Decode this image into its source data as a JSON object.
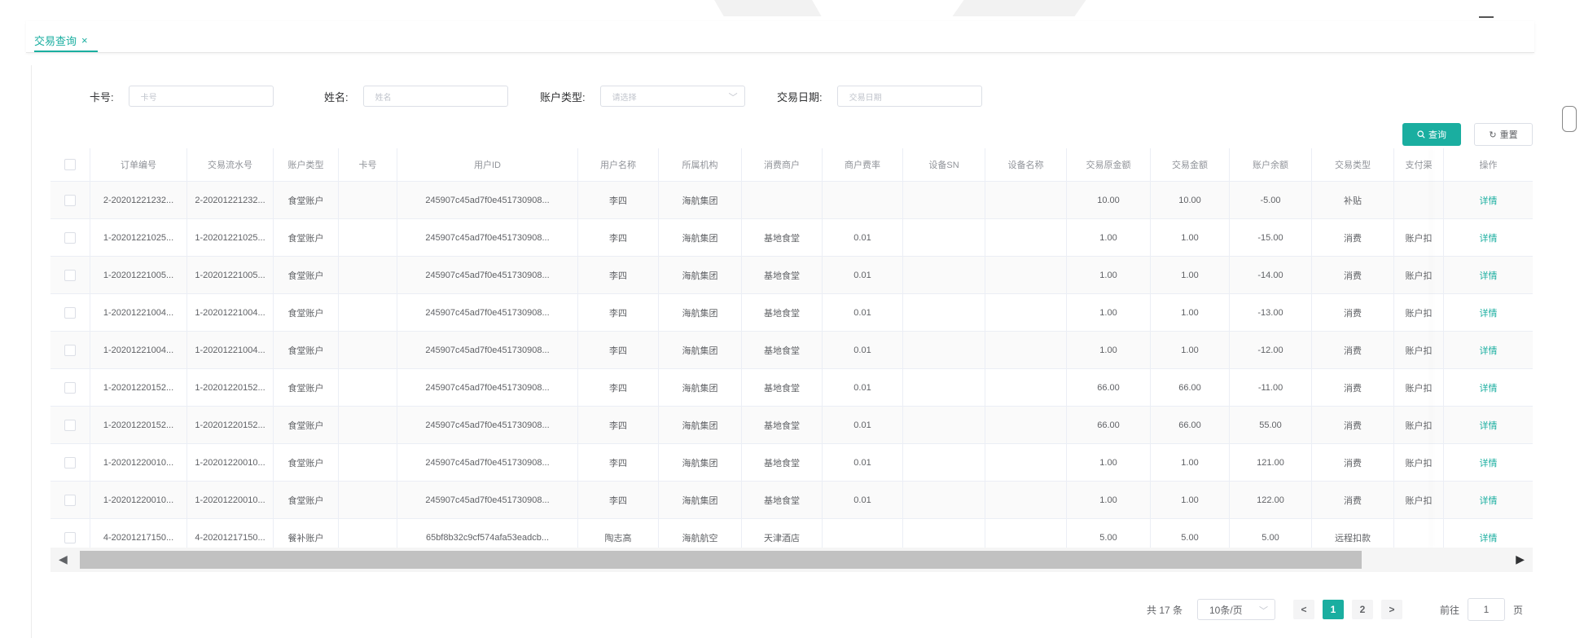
{
  "tab": {
    "label": "交易查询",
    "close": "×"
  },
  "search": {
    "card_label": "卡号:",
    "card_placeholder": "卡号",
    "name_label": "姓名:",
    "name_placeholder": "姓名",
    "acct_type_label": "账户类型:",
    "acct_type_placeholder": "请选择",
    "date_label": "交易日期:",
    "date_placeholder": "交易日期"
  },
  "buttons": {
    "query_label": "查询",
    "query_icon": "search-icon",
    "reset_label": "重置",
    "reset_icon": "refresh-icon"
  },
  "table": {
    "columns": [
      "订单编号",
      "交易流水号",
      "账户类型",
      "卡号",
      "用户ID",
      "用户名称",
      "所属机构",
      "消费商户",
      "商户费率",
      "设备SN",
      "设备名称",
      "交易原金额",
      "交易金额",
      "账户余额",
      "交易类型",
      "支付渠",
      "操作"
    ],
    "rows": [
      [
        "2-20201221232...",
        "2-20201221232...",
        "食堂账户",
        "",
        "245907c45ad7f0e451730908...",
        "李四",
        "海航集团",
        "",
        "",
        "",
        "",
        "10.00",
        "10.00",
        "-5.00",
        "补贴",
        "",
        "详情"
      ],
      [
        "1-20201221025...",
        "1-20201221025...",
        "食堂账户",
        "",
        "245907c45ad7f0e451730908...",
        "李四",
        "海航集团",
        "基地食堂",
        "0.01",
        "",
        "",
        "1.00",
        "1.00",
        "-15.00",
        "消费",
        "账户扣",
        "详情"
      ],
      [
        "1-20201221005...",
        "1-20201221005...",
        "食堂账户",
        "",
        "245907c45ad7f0e451730908...",
        "李四",
        "海航集团",
        "基地食堂",
        "0.01",
        "",
        "",
        "1.00",
        "1.00",
        "-14.00",
        "消费",
        "账户扣",
        "详情"
      ],
      [
        "1-20201221004...",
        "1-20201221004...",
        "食堂账户",
        "",
        "245907c45ad7f0e451730908...",
        "李四",
        "海航集团",
        "基地食堂",
        "0.01",
        "",
        "",
        "1.00",
        "1.00",
        "-13.00",
        "消费",
        "账户扣",
        "详情"
      ],
      [
        "1-20201221004...",
        "1-20201221004...",
        "食堂账户",
        "",
        "245907c45ad7f0e451730908...",
        "李四",
        "海航集团",
        "基地食堂",
        "0.01",
        "",
        "",
        "1.00",
        "1.00",
        "-12.00",
        "消费",
        "账户扣",
        "详情"
      ],
      [
        "1-20201220152...",
        "1-20201220152...",
        "食堂账户",
        "",
        "245907c45ad7f0e451730908...",
        "李四",
        "海航集团",
        "基地食堂",
        "0.01",
        "",
        "",
        "66.00",
        "66.00",
        "-11.00",
        "消费",
        "账户扣",
        "详情"
      ],
      [
        "1-20201220152...",
        "1-20201220152...",
        "食堂账户",
        "",
        "245907c45ad7f0e451730908...",
        "李四",
        "海航集团",
        "基地食堂",
        "0.01",
        "",
        "",
        "66.00",
        "66.00",
        "55.00",
        "消费",
        "账户扣",
        "详情"
      ],
      [
        "1-20201220010...",
        "1-20201220010...",
        "食堂账户",
        "",
        "245907c45ad7f0e451730908...",
        "李四",
        "海航集团",
        "基地食堂",
        "0.01",
        "",
        "",
        "1.00",
        "1.00",
        "121.00",
        "消费",
        "账户扣",
        "详情"
      ],
      [
        "1-20201220010...",
        "1-20201220010...",
        "食堂账户",
        "",
        "245907c45ad7f0e451730908...",
        "李四",
        "海航集团",
        "基地食堂",
        "0.01",
        "",
        "",
        "1.00",
        "1.00",
        "122.00",
        "消费",
        "账户扣",
        "详情"
      ],
      [
        "4-20201217150...",
        "4-20201217150...",
        "餐补账户",
        "",
        "65bf8b32c9cf574afa53eadcb...",
        "陶志高",
        "海航航空",
        "天津酒店",
        "",
        "",
        "",
        "5.00",
        "5.00",
        "5.00",
        "远程扣款",
        "",
        "详情"
      ]
    ]
  },
  "pagination": {
    "total": "共 17 条",
    "page_size": "10条/页",
    "prev": "<",
    "pages": [
      "1",
      "2"
    ],
    "current": "1",
    "next": ">",
    "goto_label": "前往",
    "goto_value": "1",
    "page_unit": "页"
  },
  "colors": {
    "accent": "#1aaea0"
  }
}
